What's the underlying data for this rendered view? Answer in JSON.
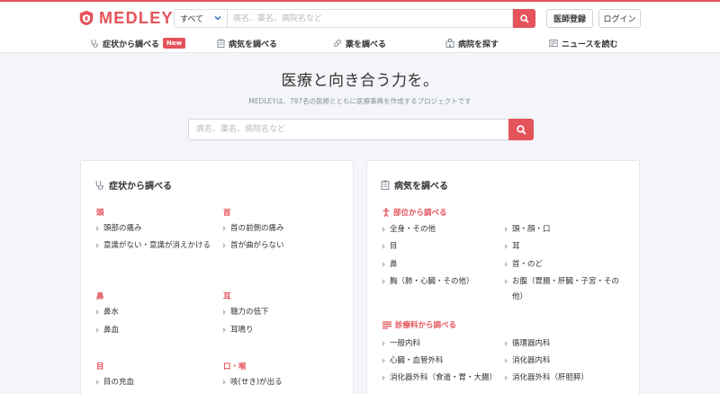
{
  "brand": {
    "name": "MEDLEY",
    "color": "#e5535b"
  },
  "search": {
    "scope": "すべて",
    "placeholder": "病名、薬名、病院名など"
  },
  "header_buttons": {
    "doctor_register": "医師登録",
    "login": "ログイン"
  },
  "nav": [
    {
      "label": "症状から調べる",
      "icon": "stethoscope-icon",
      "badge": "New"
    },
    {
      "label": "病気を調べる",
      "icon": "clipboard-icon"
    },
    {
      "label": "薬を調べる",
      "icon": "pill-icon"
    },
    {
      "label": "病院を探す",
      "icon": "hospital-icon"
    },
    {
      "label": "ニュースを読む",
      "icon": "newspaper-icon"
    }
  ],
  "hero": {
    "title": "医療と向き合う力を。",
    "subtitle": "MEDLEYは、787名の医師とともに医療事典を作成するプロジェクトです",
    "placeholder": "病名、薬名、病院名など"
  },
  "symptoms_card": {
    "title": "症状から調べる",
    "groups": [
      {
        "heading": "頭",
        "items": [
          "頭部の痛み",
          "意識がない・意識が消えかける"
        ]
      },
      {
        "heading": "首",
        "items": [
          "首の前側の痛み",
          "首が曲がらない"
        ]
      },
      {
        "heading": "鼻",
        "items": [
          "鼻水",
          "鼻血"
        ]
      },
      {
        "heading": "耳",
        "items": [
          "聴力の低下",
          "耳鳴り"
        ]
      },
      {
        "heading": "目",
        "items": [
          "目の充血"
        ]
      },
      {
        "heading": "口・喉",
        "items": [
          "咳(せき)が出る"
        ]
      }
    ]
  },
  "disease_card": {
    "title": "病気を調べる",
    "by_body_part": {
      "heading": "部位から調べる",
      "items": [
        "全身・その他",
        "頭・顔・口",
        "目",
        "耳",
        "鼻",
        "首・のど",
        "胸（肺・心臓・その他）",
        "お腹（胃腸・肝臓・子宮・その他）"
      ]
    },
    "by_department": {
      "heading": "診療科から調べる",
      "items": [
        "一般内科",
        "循環器内科",
        "心臓・血管外科",
        "消化器内科",
        "消化器外科（食道・胃・大腸）",
        "消化器外科（肝胆膵）"
      ]
    }
  }
}
